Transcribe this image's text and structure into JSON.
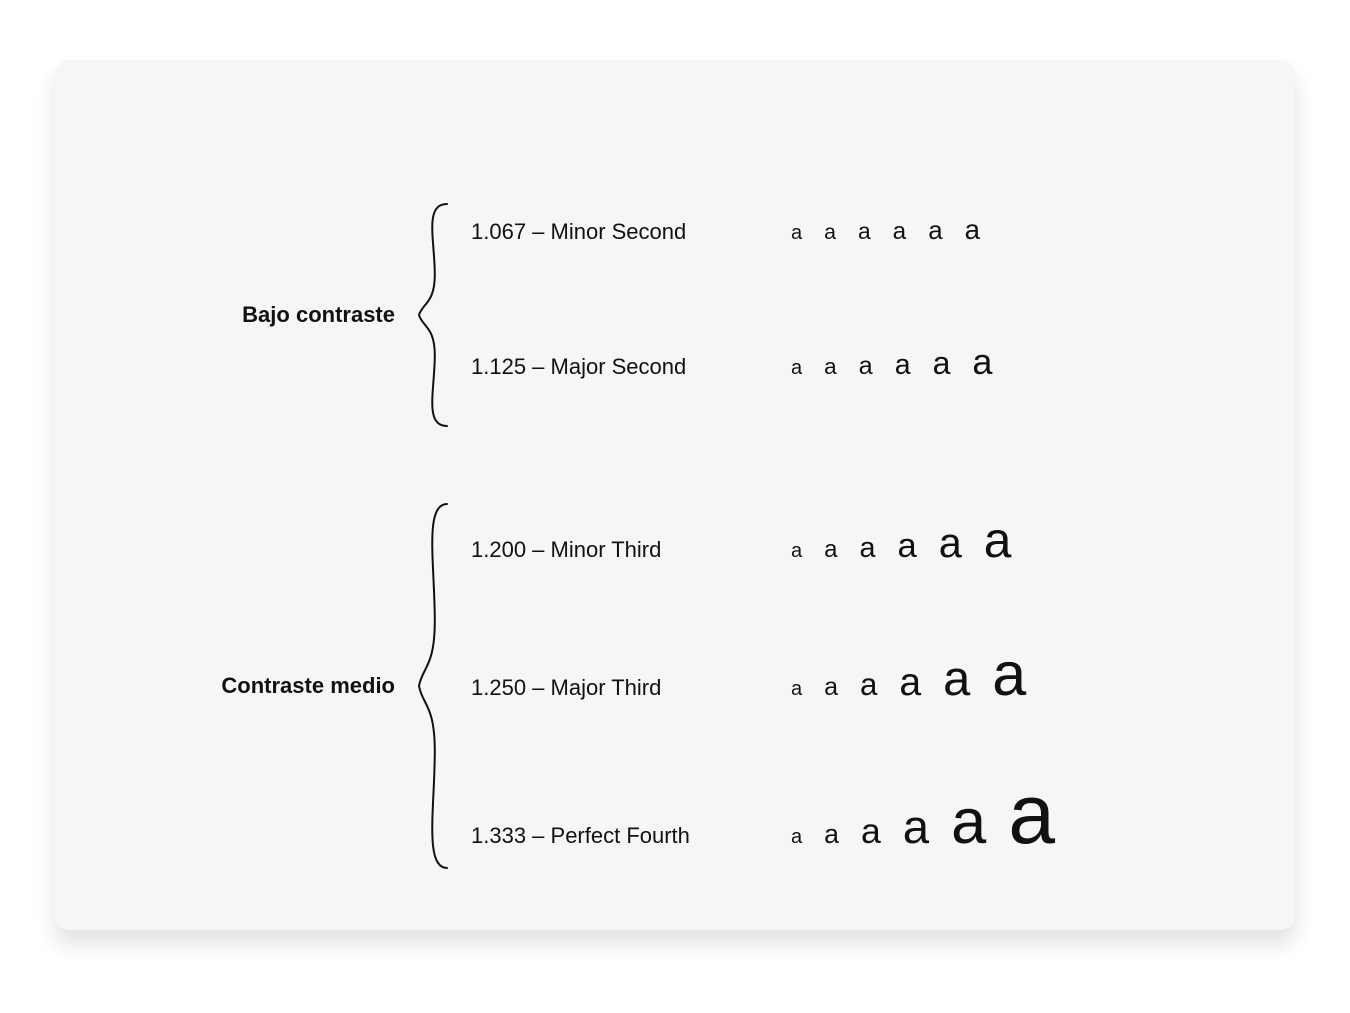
{
  "glyph": "a",
  "baseFontSize": 20,
  "steps": 6,
  "groups": [
    {
      "title": "Bajo contraste",
      "scales": [
        {
          "ratio": 1.067,
          "ratioText": "1.067",
          "name": "Minor Second"
        },
        {
          "ratio": 1.125,
          "ratioText": "1.125",
          "name": "Major Second"
        }
      ]
    },
    {
      "title": "Contraste medio",
      "scales": [
        {
          "ratio": 1.2,
          "ratioText": "1.200",
          "name": "Minor Third"
        },
        {
          "ratio": 1.25,
          "ratioText": "1.250",
          "name": "Major Third"
        },
        {
          "ratio": 1.333,
          "ratioText": "1.333",
          "name": "Perfect Fourth"
        }
      ]
    }
  ]
}
